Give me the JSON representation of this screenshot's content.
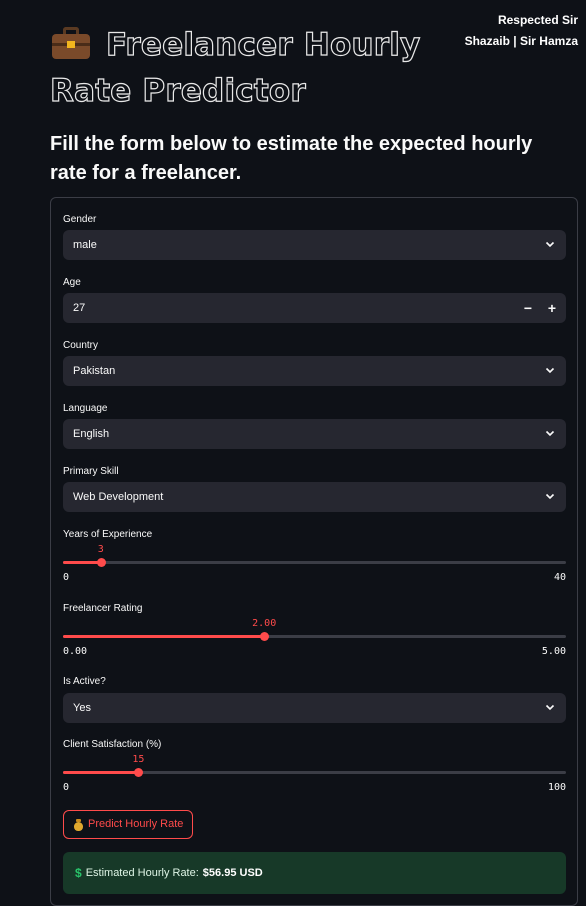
{
  "header": {
    "title": "Freelancer Hourly Rate Predictor",
    "title_icon": "briefcase-icon",
    "credit_line1": "Respected Sir",
    "credit_line2": "Shazaib | Sir Hamza"
  },
  "subtitle": "Fill the form below to estimate the expected hourly rate for a freelancer.",
  "form": {
    "gender": {
      "label": "Gender",
      "value": "male"
    },
    "age": {
      "label": "Age",
      "value": "27",
      "minus": "−",
      "plus": "+"
    },
    "country": {
      "label": "Country",
      "value": "Pakistan"
    },
    "language": {
      "label": "Language",
      "value": "English"
    },
    "skill": {
      "label": "Primary Skill",
      "value": "Web Development"
    },
    "experience": {
      "label": "Years of Experience",
      "value": 3,
      "value_text": "3",
      "min": 0,
      "max": 40,
      "min_text": "0",
      "max_text": "40"
    },
    "rating": {
      "label": "Freelancer Rating",
      "value": 2.0,
      "value_text": "2.00",
      "min": 0,
      "max": 5,
      "min_text": "0.00",
      "max_text": "5.00"
    },
    "active": {
      "label": "Is Active?",
      "value": "Yes"
    },
    "satisfaction": {
      "label": "Client Satisfaction (%)",
      "value": 15,
      "value_text": "15",
      "min": 0,
      "max": 100,
      "min_text": "0",
      "max_text": "100"
    },
    "predict_button": {
      "label": "Predict Hourly Rate",
      "icon": "money-bag-icon"
    },
    "result": {
      "prefix": "Estimated Hourly Rate:",
      "value": "$56.95 USD",
      "icon": "dollar-icon"
    }
  },
  "colors": {
    "background": "#0e1117",
    "accent": "#ff4b4b",
    "input_bg": "#262730",
    "success_bg": "#173928"
  }
}
